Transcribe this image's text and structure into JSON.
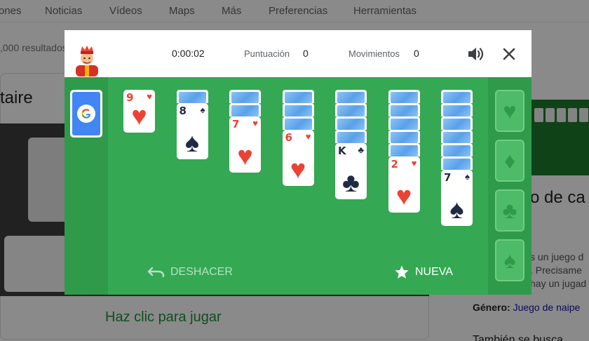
{
  "background": {
    "nav": [
      "ones",
      "Noticias",
      "Vídeos",
      "Maps",
      "Más",
      "Preferencias",
      "Herramientas"
    ],
    "stats": ",000 resultados",
    "result_title": "taire",
    "cta": "Haz clic para jugar",
    "side_title": "o de ca",
    "side_lines": [
      "s un juego d",
      ". Precisame",
      "hay un jugad"
    ],
    "genre_label": "Género:",
    "genre_value": "Juego de naipe",
    "also_label": "También se busca"
  },
  "game": {
    "timer": "0:00:02",
    "score_label": "Puntuación",
    "score_value": "0",
    "moves_label": "Movimientos",
    "moves_value": "0",
    "sound_icon": "speaker-icon",
    "close_icon": "close-icon",
    "stock_icon": "google-g-icon",
    "tableau": [
      {
        "hidden": 0,
        "rank": "9",
        "suit": "♥",
        "color": "red"
      },
      {
        "hidden": 1,
        "rank": "8",
        "suit": "♠",
        "color": "black"
      },
      {
        "hidden": 2,
        "rank": "7",
        "suit": "♥",
        "color": "red"
      },
      {
        "hidden": 3,
        "rank": "6",
        "suit": "♥",
        "color": "red"
      },
      {
        "hidden": 4,
        "rank": "K",
        "suit": "♣",
        "color": "black"
      },
      {
        "hidden": 5,
        "rank": "2",
        "suit": "♥",
        "color": "red"
      },
      {
        "hidden": 6,
        "rank": "7",
        "suit": "♠",
        "color": "black"
      }
    ],
    "foundations": [
      "♥",
      "♦",
      "♣",
      "♠"
    ],
    "undo_label": "DESHACER",
    "new_label": "NUEVA",
    "colors": {
      "felt": "#34a853",
      "felt_side": "#2f9a4a",
      "red_suit": "#ea4335",
      "black_suit": "#1f2a44",
      "card_back": "#5aa0ea"
    }
  }
}
